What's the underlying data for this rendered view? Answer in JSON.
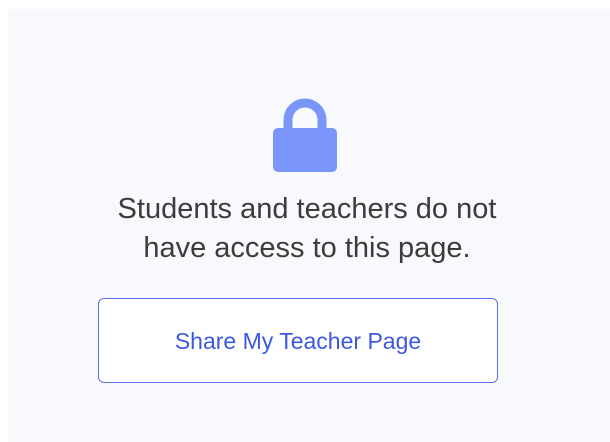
{
  "icon": {
    "name": "lock-icon",
    "color": "#7b96fb"
  },
  "message": {
    "line1": "Students and teachers do not",
    "line2": "have access to this page."
  },
  "share_button": {
    "label": "Share My Teacher Page",
    "border_color": "#5c72f0",
    "text_color": "#3d58df"
  }
}
